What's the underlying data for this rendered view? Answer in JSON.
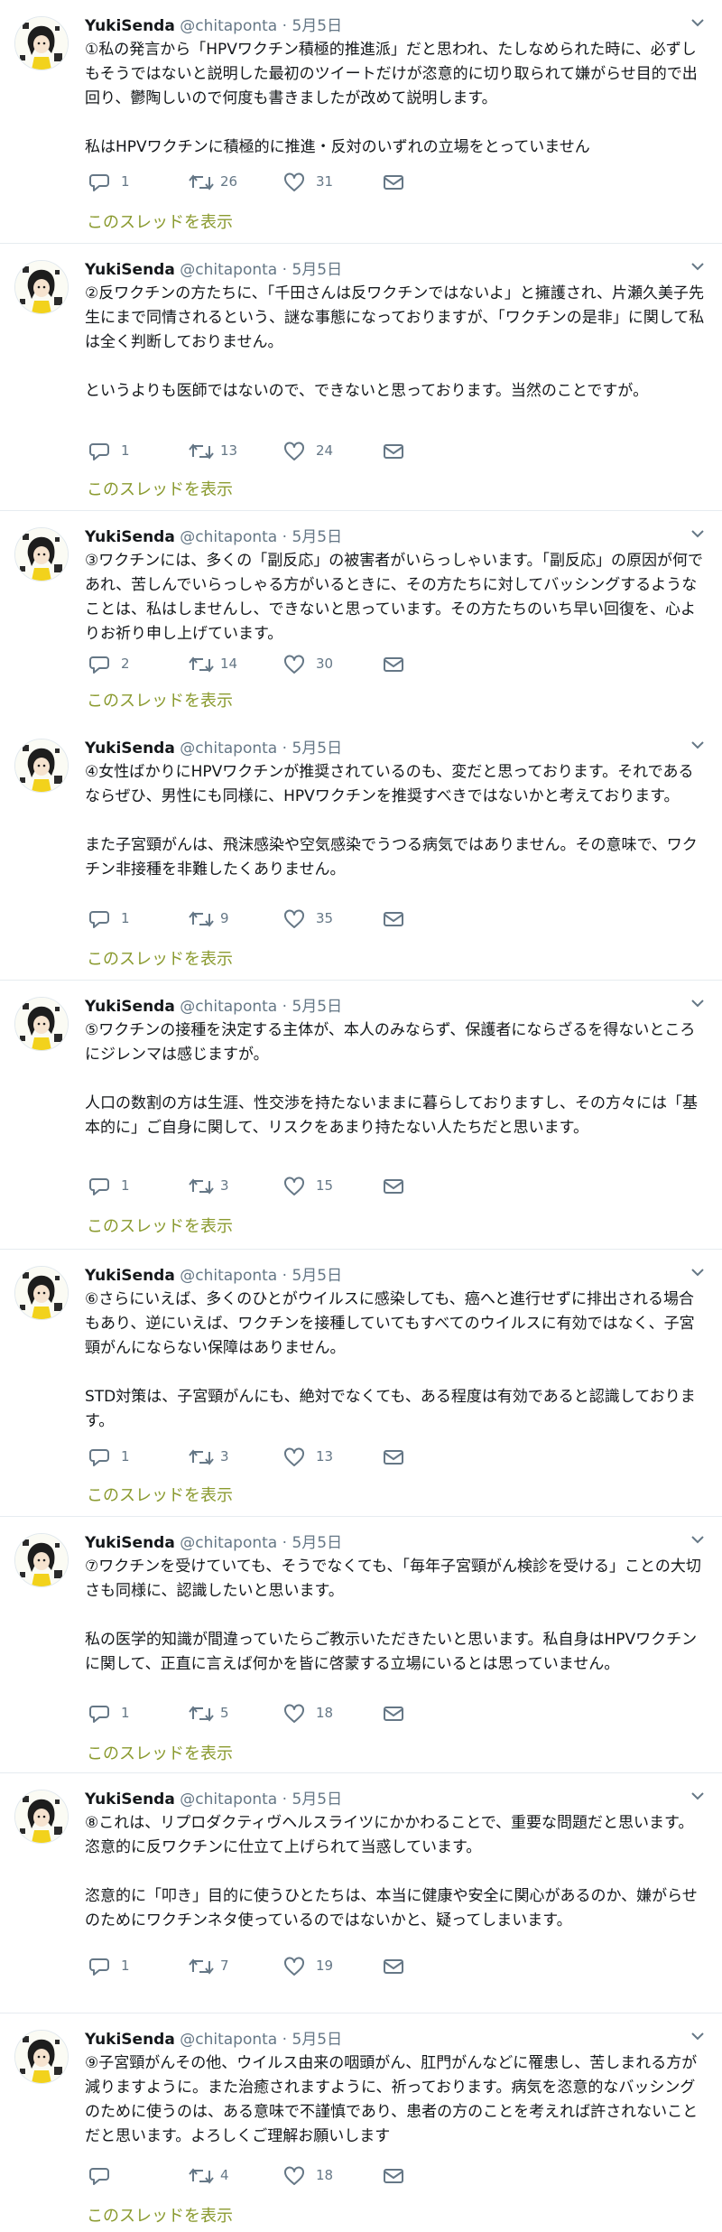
{
  "user": {
    "name": "YukiSenda",
    "handle": "@chitaponta",
    "dot": "·",
    "date": "5月5日"
  },
  "thread_label": "このスレッドを表示",
  "tweets": [
    {
      "paragraphs": [
        "①私の発言から「HPVワクチン積極的推進派」だと思われ、たしなめられた時に、必ずしもそうではないと説明した最初のツイートだけが恣意的に切り取られて嫌がらせ目的で出回り、鬱陶しいので何度も書きましたが改めて説明します。",
        "私はHPVワクチンに積極的に推進・反対のいずれの立場をとっていません"
      ],
      "replies": "1",
      "retweets": "26",
      "likes": "31"
    },
    {
      "paragraphs": [
        "②反ワクチンの方たちに、「千田さんは反ワクチンではないよ」と擁護され、片瀬久美子先生にまで同情されるという、謎な事態になっておりますが、「ワクチンの是非」に関して私は全く判断しておりません。",
        "というよりも医師ではないので、できないと思っております。当然のことですが。"
      ],
      "replies": "1",
      "retweets": "13",
      "likes": "24"
    },
    {
      "paragraphs": [
        "③ワクチンには、多くの「副反応」の被害者がいらっしゃいます。「副反応」の原因が何であれ、苦しんでいらっしゃる方がいるときに、その方たちに対してバッシングするようなことは、私はしませんし、できないと思っています。その方たちのいち早い回復を、心よりお祈り申し上げています。"
      ],
      "replies": "2",
      "retweets": "14",
      "likes": "30"
    },
    {
      "paragraphs": [
        "④女性ばかりにHPVワクチンが推奨されているのも、変だと思っております。それであるならぜひ、男性にも同様に、HPVワクチンを推奨すべきではないかと考えております。",
        "また子宮頸がんは、飛沫感染や空気感染でうつる病気ではありません。その意味で、ワクチン非接種を非難したくありません。"
      ],
      "replies": "1",
      "retweets": "9",
      "likes": "35"
    },
    {
      "paragraphs": [
        "⑤ワクチンの接種を決定する主体が、本人のみならず、保護者にならざるを得ないところにジレンマは感じますが。",
        "人口の数割の方は生涯、性交渉を持たないままに暮らしておりますし、その方々には「基本的に」ご自身に関して、リスクをあまり持たない人たちだと思います。"
      ],
      "replies": "1",
      "retweets": "3",
      "likes": "15"
    },
    {
      "paragraphs": [
        "⑥さらにいえば、多くのひとがウイルスに感染しても、癌へと進行せずに排出される場合もあり、逆にいえば、ワクチンを接種していてもすべてのウイルスに有効ではなく、子宮頸がんにならない保障はありません。",
        "STD対策は、子宮頸がんにも、絶対でなくても、ある程度は有効であると認識しております。"
      ],
      "replies": "1",
      "retweets": "3",
      "likes": "13"
    },
    {
      "paragraphs": [
        "⑦ワクチンを受けていても、そうでなくても、「毎年子宮頸がん検診を受ける」ことの大切さも同様に、認識したいと思います。",
        "私の医学的知識が間違っていたらご教示いただきたいと思います。私自身はHPVワクチンに関して、正直に言えば何かを皆に啓蒙する立場にいるとは思っていません。"
      ],
      "replies": "1",
      "retweets": "5",
      "likes": "18"
    },
    {
      "paragraphs": [
        "⑧これは、リプロダクティヴヘルスライツにかかわることで、重要な問題だと思います。恣意的に反ワクチンに仕立て上げられて当惑しています。",
        "恣意的に「叩き」目的に使うひとたちは、本当に健康や安全に関心があるのか、嫌がらせのためにワクチンネタ使っているのではないかと、疑ってしまいます。"
      ],
      "replies": "1",
      "retweets": "7",
      "likes": "19"
    },
    {
      "paragraphs": [
        "⑨子宮頸がんその他、ウイルス由来の咽頭がん、肛門がんなどに罹患し、苦しまれる方が減りますように。また治癒されますように、祈っております。病気を恣意的なバッシングのために使うのは、ある意味で不謹慎であり、患者の方のことを考えれば許されないことだと思います。よろしくご理解お願いします"
      ],
      "replies": "",
      "retweets": "4",
      "likes": "18"
    }
  ],
  "colors": {
    "icon": "#657786",
    "thread_link": "#8a9a2f",
    "separator": "#e6ecf0"
  }
}
